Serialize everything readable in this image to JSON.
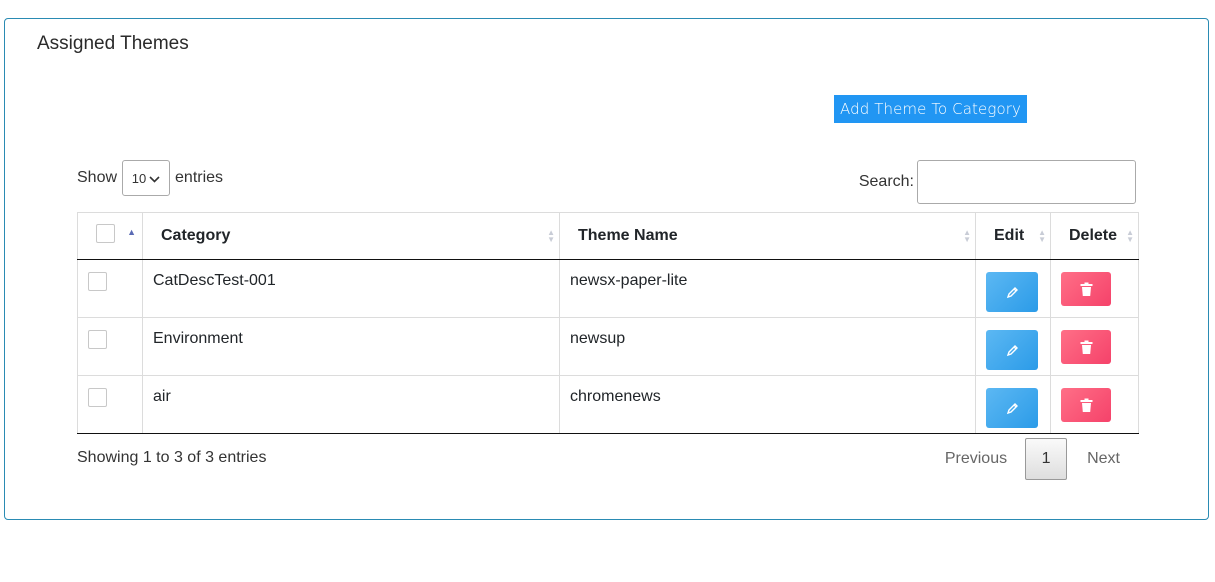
{
  "panel": {
    "title": "Assigned Themes",
    "add_button": "Add Theme To Category"
  },
  "length": {
    "prefix": "Show",
    "value": "10",
    "suffix": "entries"
  },
  "search": {
    "label": "Search:",
    "value": ""
  },
  "table": {
    "headers": {
      "category": "Category",
      "theme_name": "Theme Name",
      "edit": "Edit",
      "delete": "Delete"
    },
    "rows": [
      {
        "category": "CatDescTest-001",
        "theme_name": "newsx-paper-lite"
      },
      {
        "category": "Environment",
        "theme_name": "newsup"
      },
      {
        "category": "air",
        "theme_name": "chromenews"
      }
    ]
  },
  "footer": {
    "info": "Showing 1 to 3 of 3 entries",
    "previous": "Previous",
    "current_page": "1",
    "next": "Next"
  },
  "icons": {
    "edit": "pencil-icon",
    "delete": "trash-icon",
    "sort": "sort-arrows-icon",
    "dropdown": "chevron-down-icon"
  },
  "colors": {
    "border": "#2a8bb3",
    "primary_button": "#2196f3",
    "edit_button": "#3aa8ee",
    "delete_button": "#f7506f"
  }
}
